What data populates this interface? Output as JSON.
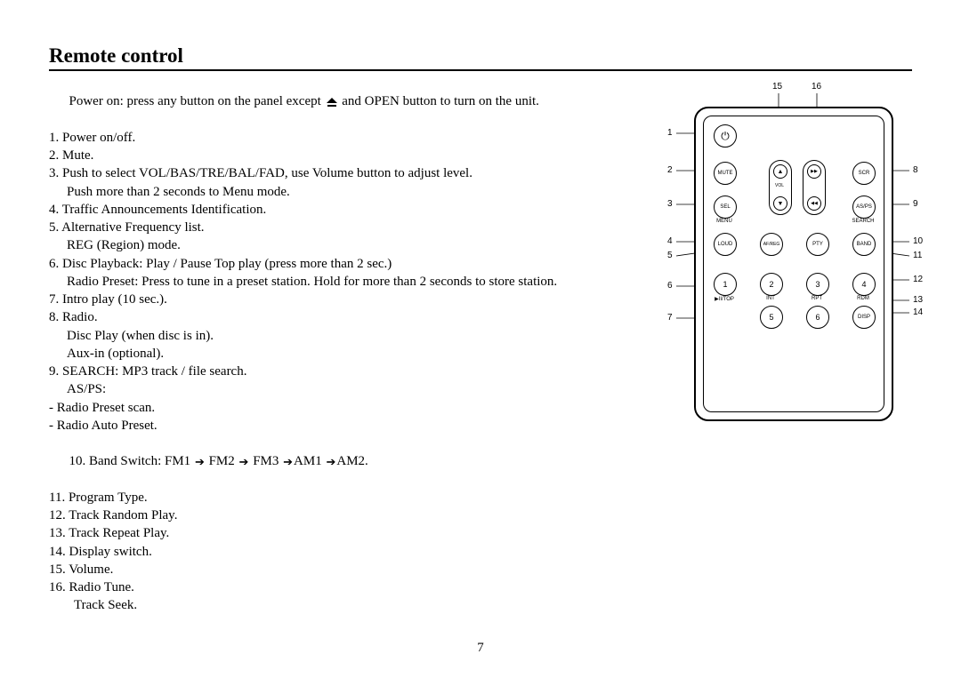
{
  "title": "Remote control",
  "intro_pre": "Power on: press any button on the panel except ",
  "intro_post": " and OPEN button to turn on the unit.",
  "items": {
    "i1": "1. Power on/off.",
    "i2": "2. Mute.",
    "i3": "3. Push to select VOL/BAS/TRE/BAL/FAD, use Volume button to adjust level.",
    "i3b": "Push more than 2 seconds to Menu mode.",
    "i4": "4. Traffic Announcements Identification.",
    "i5": "5. Alternative Frequency list.",
    "i5b": "REG (Region) mode.",
    "i6": "6. Disc Playback: Play / Pause Top play (press more than 2 sec.)",
    "i6b": "Radio Preset: Press to tune in a preset station. Hold for more than 2 seconds to store station.",
    "i7": "7. Intro play (10 sec.).",
    "i8": "8. Radio.",
    "i8b": "Disc Play (when disc is in).",
    "i8c": "Aux-in (optional).",
    "i9": "9. SEARCH: MP3 track / file search.",
    "i9b": "AS/PS:",
    "i9c": "- Radio Preset scan.",
    "i9d": "- Radio Auto Preset.",
    "i10_pre": "10. Band Switch: FM1 ",
    "i10_a": " FM2 ",
    "i10_b": " FM3 ",
    "i10_c": "AM1 ",
    "i10_d": "AM2.",
    "i11": "11. Program Type.",
    "i12": "12. Track Random Play.",
    "i13": "13. Track Repeat Play.",
    "i14": "14. Display switch.",
    "i15": "15. Volume.",
    "i16": "16. Radio Tune.",
    "i16b": "Track Seek."
  },
  "remote": {
    "buttons": {
      "power": "⏻",
      "mute": "MUTE",
      "scr": "SCR",
      "sel": "SEL",
      "menu_lbl": "MENU",
      "asps": "AS/PS",
      "search_lbl": "SEARCH",
      "loud": "LOUD",
      "afreg": "AF/REG",
      "pty": "PTY",
      "band": "BAND",
      "n1": "1",
      "n2": "2",
      "n3": "3",
      "n4": "4",
      "n5": "5",
      "n6": "6",
      "disp": "DISP",
      "top_lbl": "▶II/TOP",
      "int_lbl": "INT",
      "rpt_lbl": "RPT",
      "rdm_lbl": "RDM",
      "vol_lbl": "VOL",
      "up": "▲",
      "down": "▼",
      "left": "◀◀",
      "right": "▶▶"
    },
    "callouts": {
      "c1": "1",
      "c2": "2",
      "c3": "3",
      "c4": "4",
      "c5": "5",
      "c6": "6",
      "c7": "7",
      "c8": "8",
      "c9": "9",
      "c10": "10",
      "c11": "11",
      "c12": "12",
      "c13": "13",
      "c14": "14",
      "c15": "15",
      "c16": "16"
    }
  },
  "page_number": "7"
}
